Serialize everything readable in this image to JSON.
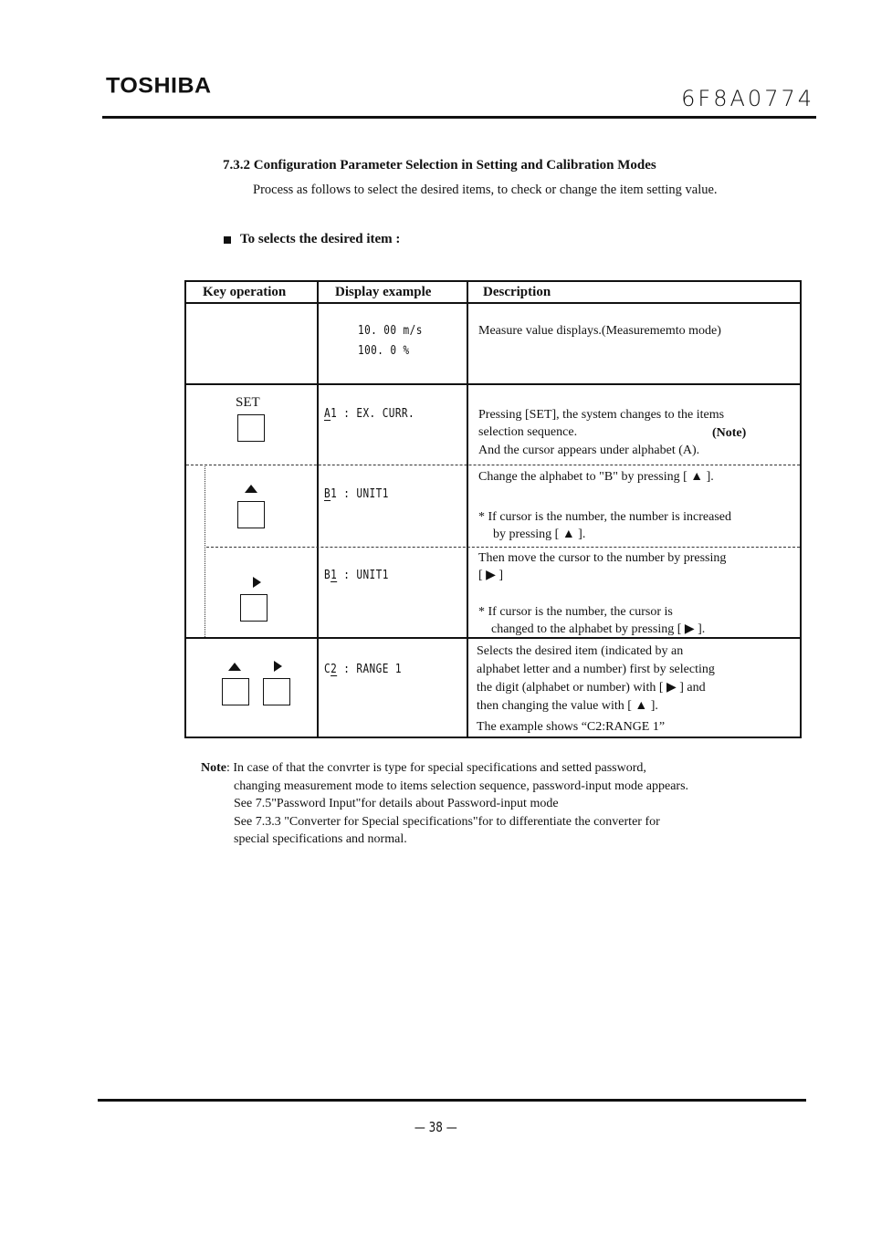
{
  "header": {
    "brand": "TOSHIBA",
    "doc_number": "6F8A0774"
  },
  "section": {
    "title": "7.3.2 Configuration Parameter Selection in Setting and Calibration Modes",
    "intro": "Process as follows to select the desired items, to check or change the item setting value.",
    "bullet": "To selects the desired item :"
  },
  "table": {
    "headers": {
      "key_operation": "Key operation",
      "display_example": "Display example",
      "description": "Description"
    },
    "rows": [
      {
        "key": "",
        "display_lines": [
          "10. 00 m/s",
          "100. 0 %"
        ],
        "description_lines": [
          "Measure value displays.(Measurememto mode)"
        ]
      },
      {
        "key": "SET",
        "display": {
          "cursor": "A",
          "rest": "1 :  EX.  CURR."
        },
        "description_lines": [
          "Pressing [SET], the system changes to the items",
          "selection sequence.",
          "And the cursor appears under alphabet (A)."
        ],
        "note_tag": "(Note)"
      },
      {
        "key": "up",
        "display": {
          "cursor": "B",
          "rest": "1 :  UNIT1"
        },
        "description_lines": [
          "Change the alphabet to \"B\" by pressing [ ▲ ]."
        ],
        "asterisk_lines": [
          "* If cursor is the number,  the number is increased",
          "by pressing [ ▲ ]."
        ]
      },
      {
        "key": "right",
        "display": {
          "prefix": "B",
          "cursor": "1",
          "rest": " :  UNIT1"
        },
        "description_lines": [
          "Then move the cursor to the number by pressing",
          "[ ▶ ]"
        ],
        "asterisk_lines": [
          "*  If  cursor  is  the  number,  the  cursor  is",
          "changed to the alphabet by pressing [  ▶  ]."
        ]
      },
      {
        "key": "up-right",
        "display": {
          "prefix": "C",
          "cursor": "2",
          "rest": " :  RANGE  1"
        },
        "description_lines": [
          "Selects the desired item (indicated by an",
          "alphabet letter and a number) first by selecting",
          "the digit (alphabet or number) with [ ▶ ] and",
          "then changing the value with [ ▲ ].",
          "The example shows “C2:RANGE  1”"
        ]
      }
    ]
  },
  "note": {
    "label": "Note",
    "lines": [
      ": In case of that the convrter is type for special specifications and setted password,",
      "changing measurement mode to items selection sequence, password-input mode appears.",
      "See 7.5\"Password Input\"for details about Password-input mode",
      "See 7.3.3 \"Converter for Special specifications\"for to differentiate the converter for",
      "special specifications and normal."
    ]
  },
  "footer": {
    "page_number": "—   38   —"
  }
}
